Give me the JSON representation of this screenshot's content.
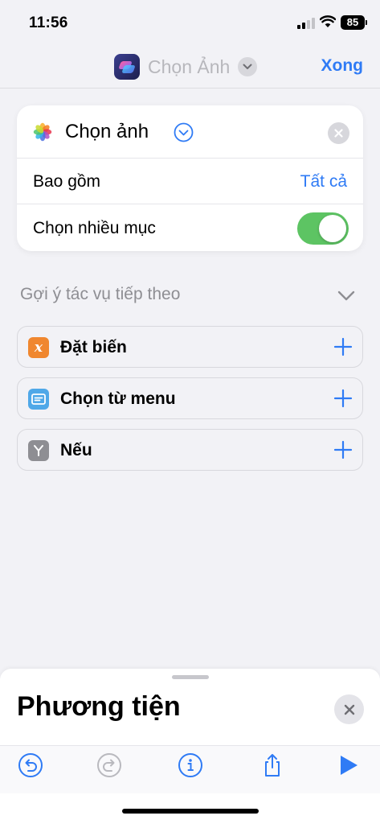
{
  "status_bar": {
    "time": "11:56",
    "battery": "85"
  },
  "nav": {
    "title": "Chọn Ảnh",
    "done_label": "Xong"
  },
  "action": {
    "title": "Chọn ảnh",
    "rows": [
      {
        "label": "Bao gồm",
        "value": "Tất cả"
      },
      {
        "label": "Chọn nhiều mục",
        "toggle_on": true
      }
    ]
  },
  "suggestions": {
    "header": "Gợi ý tác vụ tiếp theo",
    "items": [
      {
        "label": "Đặt biến",
        "icon": "variable-icon",
        "color": "#f0872f"
      },
      {
        "label": "Chọn từ menu",
        "icon": "menu-icon",
        "color": "#4fa8e8"
      },
      {
        "label": "Nếu",
        "icon": "if-icon",
        "color": "#8e8e93"
      }
    ]
  },
  "sheet": {
    "title": "Phương tiện"
  },
  "colors": {
    "accent": "#2f7bf5",
    "toggle_on": "#5dc463",
    "background": "#f2f2f6"
  }
}
